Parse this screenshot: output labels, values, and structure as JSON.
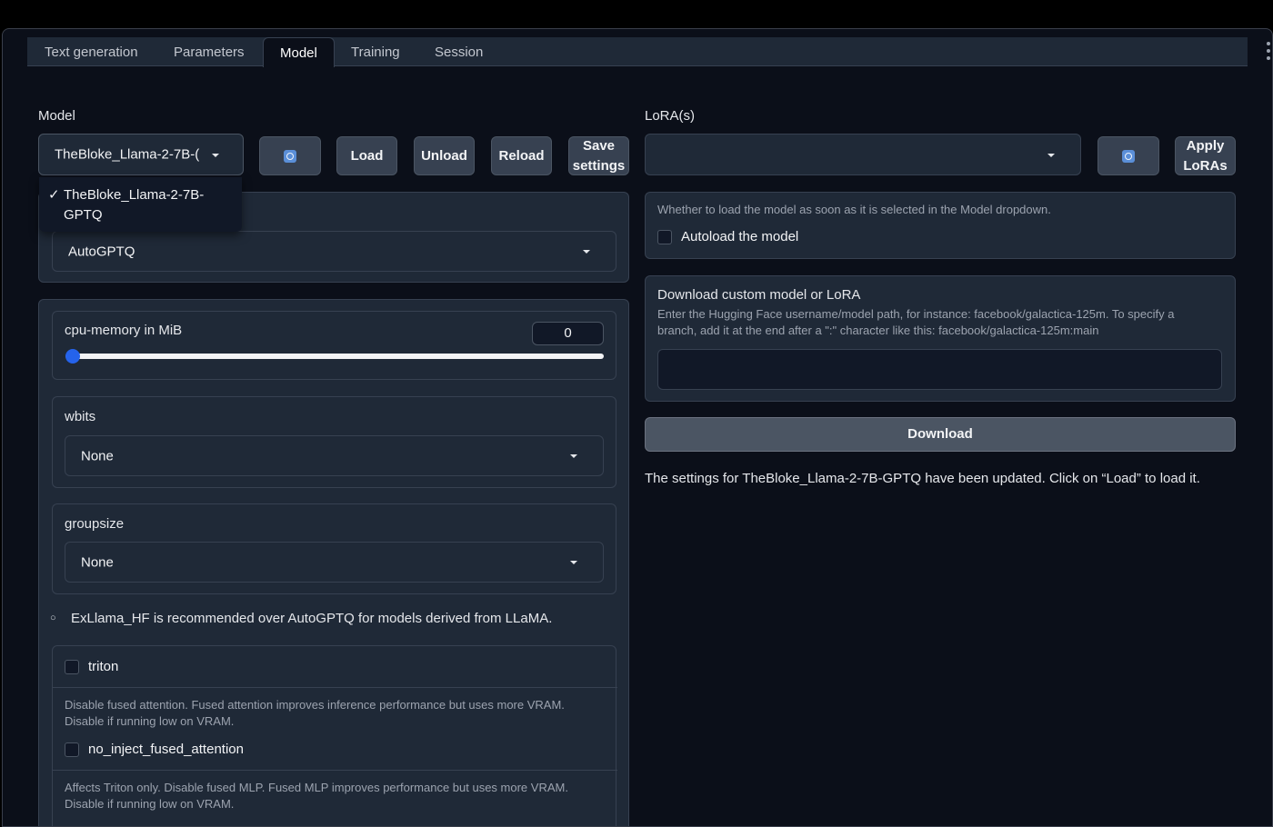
{
  "tabs": [
    {
      "label": "Text generation",
      "active": false
    },
    {
      "label": "Parameters",
      "active": false
    },
    {
      "label": "Model",
      "active": true
    },
    {
      "label": "Training",
      "active": false
    },
    {
      "label": "Session",
      "active": false
    }
  ],
  "model_section": {
    "label": "Model",
    "selected": "TheBloke_Llama-2-7B-(",
    "menu_check": "✓",
    "menu_option": "TheBloke_Llama-2-7B-GPTQ",
    "buttons": {
      "load": "Load",
      "unload": "Unload",
      "reload": "Reload",
      "save": "Save settings"
    }
  },
  "loader": {
    "selected": "AutoGPTQ"
  },
  "cpu_memory": {
    "label": "cpu-memory in MiB",
    "value": "0",
    "fraction": 0
  },
  "wbits": {
    "label": "wbits",
    "selected": "None"
  },
  "groupsize": {
    "label": "groupsize",
    "selected": "None"
  },
  "recommendation": "ExLlama_HF is recommended over AutoGPTQ for models derived from LLaMA.",
  "bullet": "○",
  "triton": {
    "label": "triton",
    "checked": false
  },
  "no_inject": {
    "info": "Disable fused attention. Fused attention improves inference performance but uses more VRAM. Disable if running low on VRAM.",
    "label": "no_inject_fused_attention",
    "checked": false
  },
  "fused_mlp_info": "Affects Triton only. Disable fused MLP. Fused MLP improves performance but uses more VRAM. Disable if running low on VRAM.",
  "lora": {
    "label": "LoRA(s)",
    "selected": "",
    "apply": "Apply LoRAs"
  },
  "autoload": {
    "info": "Whether to load the model as soon as it is selected in the Model dropdown.",
    "label": "Autoload the model",
    "checked": false
  },
  "download": {
    "title": "Download custom model or LoRA",
    "info": "Enter the Hugging Face username/model path, for instance: facebook/galactica-125m. To specify a branch, add it at the end after a \":\" character like this: facebook/galactica-125m:main",
    "input_value": "",
    "button": "Download"
  },
  "status_message": "The settings for TheBloke_Llama-2-7B-GPTQ have been updated. Click on “Load” to load it.",
  "colors": {
    "accent": "#2563eb",
    "background": "#0b0f19",
    "panel": "#1f2937",
    "refresh_icon": "#5b8fd8"
  }
}
